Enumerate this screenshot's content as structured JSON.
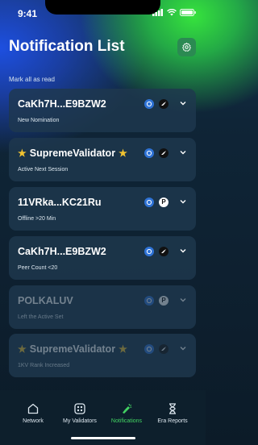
{
  "status": {
    "time": "9:41"
  },
  "header": {
    "title": "Notification List",
    "settings_icon": "gear-icon"
  },
  "mark_all_label": "Mark all as read",
  "notifications": [
    {
      "title": "CaKh7H...E9BZW2",
      "subtitle": "New Nomination",
      "star": false,
      "second_icon": "bird-icon",
      "read": false
    },
    {
      "title": "SupremeValidator",
      "subtitle": "Active Next Session",
      "star": true,
      "second_icon": "bird-icon",
      "read": false
    },
    {
      "title": "11VRka...KC21Ru",
      "subtitle": "Offline >20 Min",
      "star": false,
      "second_icon": "p-icon",
      "read": false
    },
    {
      "title": "CaKh7H...E9BZW2",
      "subtitle": "Peer Count <20",
      "star": false,
      "second_icon": "bird-icon",
      "read": false
    },
    {
      "title": "POLKALUV",
      "subtitle": "Left the Active Set",
      "star": false,
      "second_icon": "p-icon",
      "read": true
    },
    {
      "title": "SupremeValidator",
      "subtitle": "1KV Rank Increased",
      "star": true,
      "second_icon": "bird-icon",
      "read": true
    }
  ],
  "tabs": [
    {
      "label": "Network",
      "icon": "home-icon",
      "active": false
    },
    {
      "label": "My Validators",
      "icon": "validators-icon",
      "active": false
    },
    {
      "label": "Notifications",
      "icon": "notification-flashlight-icon",
      "active": true
    },
    {
      "label": "Era Reports",
      "icon": "hourglass-icon",
      "active": false
    }
  ],
  "colors": {
    "accent": "#43d463",
    "card": "#1e384e",
    "badge": "#2f73d6"
  }
}
